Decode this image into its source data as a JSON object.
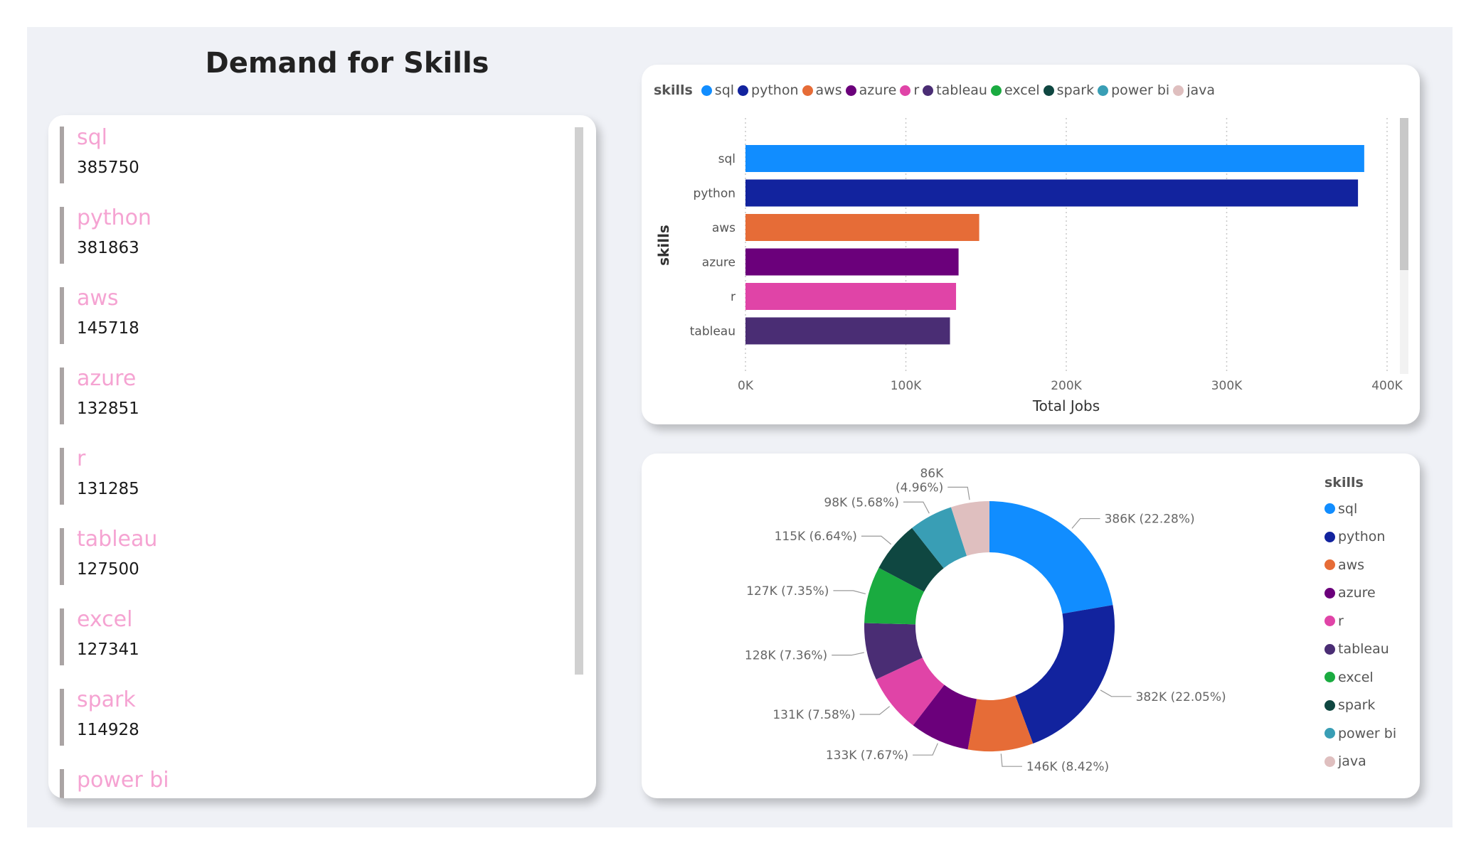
{
  "page_title": "Demand for Skills",
  "list": [
    {
      "name": "sql",
      "value": "385750"
    },
    {
      "name": "python",
      "value": "381863"
    },
    {
      "name": "aws",
      "value": "145718"
    },
    {
      "name": "azure",
      "value": "132851"
    },
    {
      "name": "r",
      "value": "131285"
    },
    {
      "name": "tableau",
      "value": "127500"
    },
    {
      "name": "excel",
      "value": "127341"
    },
    {
      "name": "spark",
      "value": "114928"
    },
    {
      "name": "power bi",
      "value": ""
    }
  ],
  "legend": {
    "title": "skills",
    "items": [
      {
        "name": "sql",
        "color": "#118dff"
      },
      {
        "name": "python",
        "color": "#12239e"
      },
      {
        "name": "aws",
        "color": "#e66c37"
      },
      {
        "name": "azure",
        "color": "#6b007b"
      },
      {
        "name": "r",
        "color": "#e044a7"
      },
      {
        "name": "tableau",
        "color": "#4a2d74"
      },
      {
        "name": "excel",
        "color": "#1aab40"
      },
      {
        "name": "spark",
        "color": "#0f4741"
      },
      {
        "name": "power bi",
        "color": "#399eb5"
      },
      {
        "name": "java",
        "color": "#dfbfbf"
      }
    ]
  },
  "chart_data": [
    {
      "type": "bar",
      "orientation": "horizontal",
      "categories": [
        "sql",
        "python",
        "aws",
        "azure",
        "r",
        "tableau"
      ],
      "values": [
        385750,
        381863,
        145718,
        132851,
        131285,
        127500
      ],
      "colors": [
        "#118dff",
        "#12239e",
        "#e66c37",
        "#6b007b",
        "#e044a7",
        "#4a2d74"
      ],
      "xlabel": "Total Jobs",
      "ylabel": "skills",
      "xlim": [
        0,
        400000
      ],
      "x_ticks": [
        "0K",
        "100K",
        "200K",
        "300K",
        "400K"
      ],
      "grid": "vertical dotted",
      "legend_position": "top"
    },
    {
      "type": "pie",
      "style": "donut",
      "categories": [
        "sql",
        "python",
        "aws",
        "azure",
        "r",
        "tableau",
        "excel",
        "spark",
        "power bi",
        "java"
      ],
      "values": [
        386,
        382,
        146,
        133,
        131,
        128,
        127,
        115,
        98,
        86
      ],
      "labels": [
        "386K (22.28%)",
        "382K (22.05%)",
        "146K (8.42%)",
        "133K (7.67%)",
        "131K (7.58%)",
        "128K (7.36%)",
        "127K (7.35%)",
        "115K (6.64%)",
        "98K (5.68%)",
        "86K\n(4.96%)"
      ],
      "colors": [
        "#118dff",
        "#12239e",
        "#e66c37",
        "#6b007b",
        "#e044a7",
        "#4a2d74",
        "#1aab40",
        "#0f4741",
        "#399eb5",
        "#dfbfbf"
      ],
      "legend_position": "right"
    }
  ]
}
